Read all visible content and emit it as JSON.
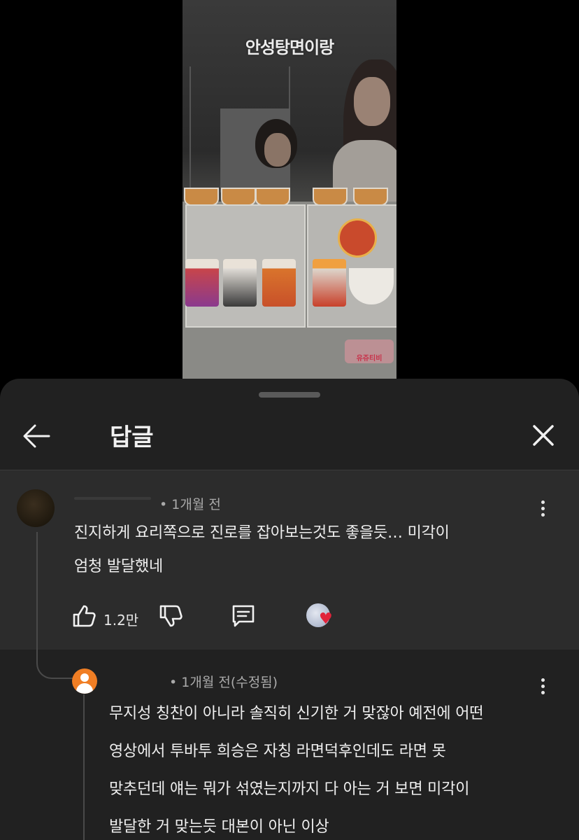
{
  "video": {
    "caption": "안성탕면이랑",
    "watermark": "유쥬티비"
  },
  "sheet": {
    "title": "답글"
  },
  "comment": {
    "time": "• 1개월 전",
    "lines": [
      "진지하게 요리쪽으로 진로를 잡아보는것도 좋을듯… 미각이",
      "엄청 발달했네"
    ],
    "like_count": "1.2만"
  },
  "reply": {
    "time": "• 1개월 전(수정됨)",
    "lines": [
      "무지성 칭찬이 아니라 솔직히 신기한 거 맞잖아 예전에 어떤",
      "영상에서 투바투 희승은 자칭 라면덕후인데도 라면 못",
      "맞추던데 얘는 뭐가 섞였는지까지 다 아는 거 보면 미각이",
      "발달한 거 맞는듯 대본이 아닌 이상"
    ]
  },
  "colors": {
    "background": "#000000",
    "sheet": "#212121",
    "highlighted_comment": "#2c2c2c",
    "heart": "#e1243b",
    "avatar_orange": "#f07e24"
  },
  "icons": [
    "back-arrow-icon",
    "close-icon",
    "more-vert-icon",
    "thumb-up-icon",
    "thumb-down-icon",
    "reply-comment-icon",
    "creator-heart-icon",
    "default-avatar-icon"
  ]
}
